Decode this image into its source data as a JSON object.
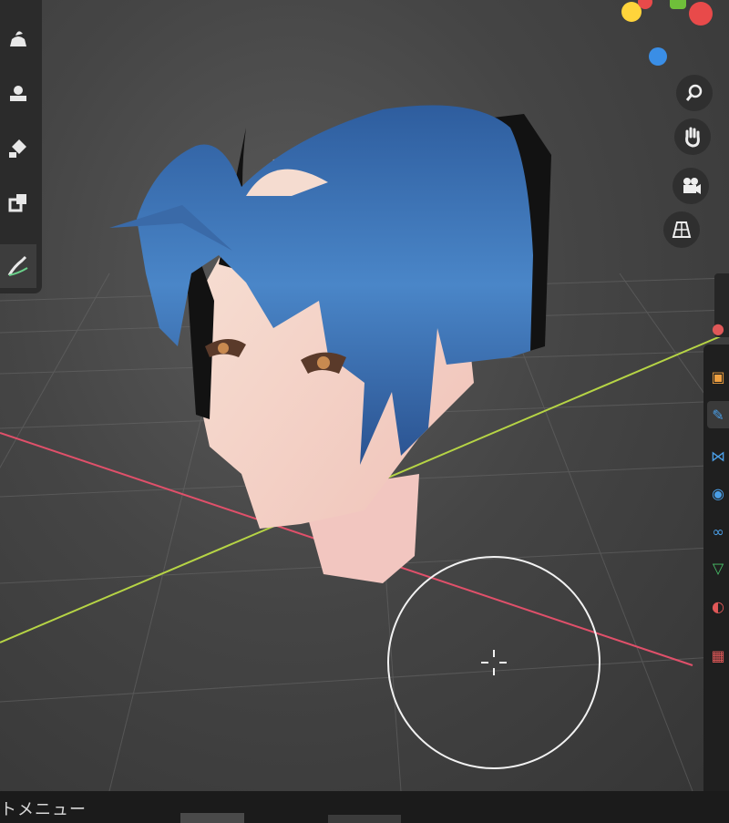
{
  "status_bar": {
    "context_menu_label": "トメニュー"
  },
  "toolbar": {
    "tools": [
      {
        "icon": "draw-brush-icon"
      },
      {
        "icon": "clay-strips-icon"
      },
      {
        "icon": "fill-bucket-icon"
      },
      {
        "icon": "clone-icon"
      },
      {
        "icon": "annotate-icon"
      }
    ]
  },
  "navigation": {
    "gizmo_colors": [
      "#ffd43b",
      "#e84a4a",
      "#3a8ee6",
      "#6fbf3a"
    ],
    "buttons": [
      "zoom-icon",
      "pan-hand-icon",
      "camera-icon",
      "perspective-grid-icon"
    ]
  },
  "properties_tabs": [
    {
      "icon": "render-icon",
      "color": "#e05858"
    },
    {
      "icon": "object-icon",
      "color": "#f0a040"
    },
    {
      "icon": "modifier-wrench-icon",
      "color": "#4a9ee6"
    },
    {
      "icon": "particles-icon",
      "color": "#4a9ee6"
    },
    {
      "icon": "physics-icon",
      "color": "#4a9ee6"
    },
    {
      "icon": "constraints-icon",
      "color": "#4a9ee6"
    },
    {
      "icon": "object-data-icon",
      "color": "#4ac46a"
    },
    {
      "icon": "material-icon",
      "color": "#e05858"
    },
    {
      "icon": "texture-icon",
      "color": "#e05858"
    }
  ],
  "colors": {
    "x_axis": "#e0506a",
    "y_axis": "#b6d445",
    "hair": "#3b6fb0",
    "skin": "#f4d6c8",
    "brush_circle": "#f2f2f2"
  }
}
